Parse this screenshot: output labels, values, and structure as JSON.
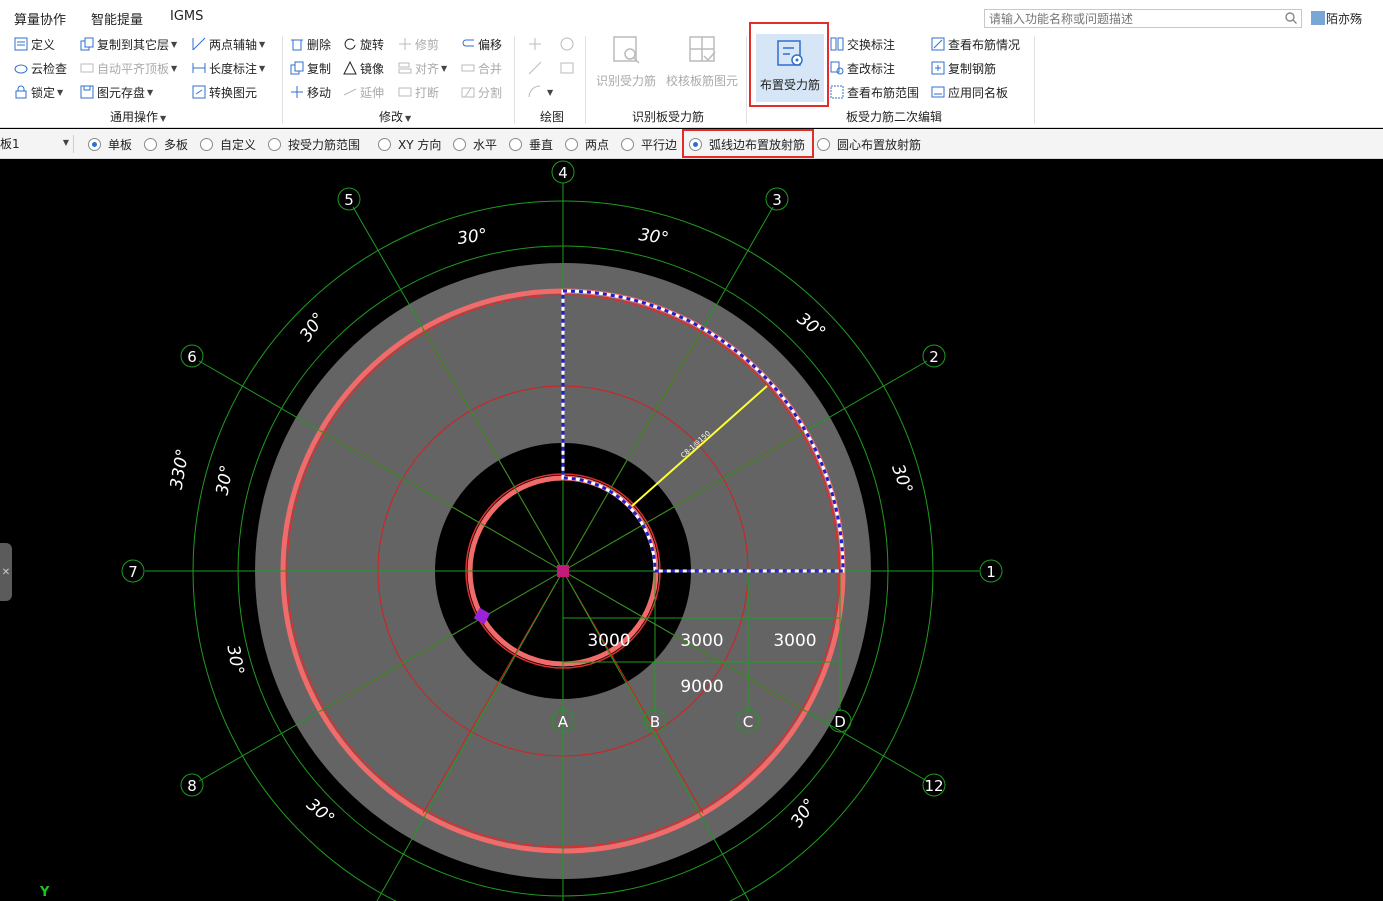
{
  "menubar": {
    "tabs": [
      "算量协作",
      "智能提量",
      "IGMS"
    ],
    "search_placeholder": "请输入功能名称或问题描述",
    "username": "陌亦殇"
  },
  "ribbon": {
    "general": {
      "items": [
        "定义",
        "云检查",
        "锁定",
        "复制到其它层",
        "自动平齐顶板",
        "图元存盘",
        "两点辅轴",
        "长度标注",
        "转换图元"
      ],
      "group_label": "通用操作"
    },
    "modify": {
      "items": [
        "删除",
        "复制",
        "移动",
        "旋转",
        "镜像",
        "延伸",
        "修剪",
        "对齐",
        "打断",
        "偏移",
        "合并",
        "分割"
      ],
      "group_label": "修改"
    },
    "draw": {
      "group_label": "绘图"
    },
    "identify": {
      "items": [
        "识别受力筋",
        "校核板筋图元"
      ],
      "group_label": "识别板受力筋"
    },
    "edit2": {
      "place_label": "布置受力筋",
      "items": [
        "交换标注",
        "查改标注",
        "查看布筋范围",
        "查看布筋情况",
        "复制钢筋",
        "应用同名板"
      ],
      "group_label": "板受力筋二次编辑"
    }
  },
  "options": {
    "layer_select": "板1",
    "radios": [
      "单板",
      "多板",
      "自定义",
      "按受力筋范围",
      "XY 方向",
      "水平",
      "垂直",
      "两点",
      "平行边",
      "弧线边布置放射筋",
      "圆心布置放射筋"
    ],
    "checked": [
      "单板",
      "弧线边布置放射筋"
    ]
  },
  "drawing": {
    "axis_labels": [
      "1",
      "2",
      "3",
      "4",
      "5",
      "6",
      "7",
      "8",
      "12",
      "A",
      "B",
      "C",
      "D"
    ],
    "angle_labels": [
      "30°",
      "30°",
      "30°",
      "30°",
      "30°",
      "30°",
      "330°",
      "30°",
      "30°",
      "30°",
      "30°"
    ],
    "dim_labels": [
      "3000",
      "3000",
      "3000",
      "9000"
    ],
    "rebar_label": "C8-1@150",
    "y_axis_label": "Y"
  },
  "colors": {
    "accent": "#2e6fd0",
    "highlight": "#e32d2d",
    "slab": "#646464",
    "slab_edge": "#f26b6b",
    "grid": "#1f9b1f",
    "radial": "#d81e1e",
    "rebar": "#ffff33",
    "boundary": "#2020c8"
  }
}
